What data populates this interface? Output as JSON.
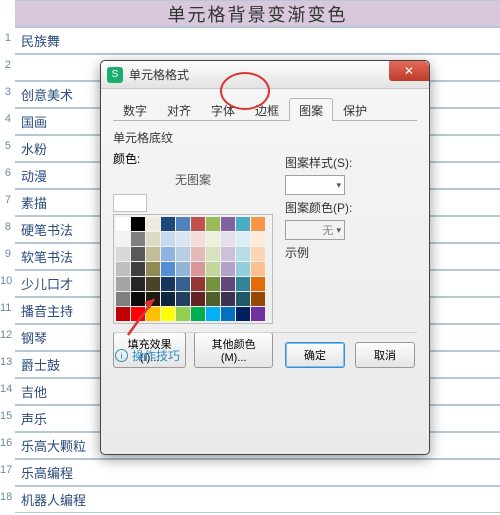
{
  "header": {
    "title": "单元格背景变渐变色"
  },
  "rows": [
    {
      "n": 1,
      "v": "民族舞"
    },
    {
      "n": 2,
      "v": ""
    },
    {
      "n": 3,
      "v": "创意美术"
    },
    {
      "n": 4,
      "v": "国画"
    },
    {
      "n": 5,
      "v": "水粉"
    },
    {
      "n": 6,
      "v": "动漫"
    },
    {
      "n": 7,
      "v": "素描"
    },
    {
      "n": 8,
      "v": "硬笔书法"
    },
    {
      "n": 9,
      "v": "软笔书法"
    },
    {
      "n": 10,
      "v": "少儿口才"
    },
    {
      "n": 11,
      "v": "播音主持"
    },
    {
      "n": 12,
      "v": "钢琴"
    },
    {
      "n": 13,
      "v": "爵士鼓"
    },
    {
      "n": 14,
      "v": "吉他"
    },
    {
      "n": 15,
      "v": "声乐"
    },
    {
      "n": 16,
      "v": "乐高大颗粒"
    },
    {
      "n": 17,
      "v": "乐高编程"
    },
    {
      "n": 18,
      "v": "机器人编程"
    }
  ],
  "dialog": {
    "app_icon_letter": "S",
    "title": "单元格格式",
    "tabs": [
      "数字",
      "对齐",
      "字体",
      "边框",
      "图案",
      "保护"
    ],
    "active_tab": 4,
    "section": "单元格底纹",
    "color_label": "颜色:",
    "no_pattern": "无图案",
    "right": {
      "style_label": "图案样式(S):",
      "color_label": "图案颜色(P):",
      "color_value": "无",
      "sample_label": "示例"
    },
    "fill_effects_btn": "填充效果(I)...",
    "other_colors_btn": "其他颜色(M)...",
    "tips": "操作技巧",
    "ok": "确定",
    "cancel": "取消"
  },
  "palette_rows": [
    [
      "#ffffff",
      "#000000",
      "#eeece1",
      "#1f497d",
      "#4f81bd",
      "#c0504d",
      "#9bbb59",
      "#8064a2",
      "#4bacc6",
      "#f79646"
    ],
    [
      "#f2f2f2",
      "#7f7f7f",
      "#ddd9c3",
      "#c6d9f0",
      "#dbe5f1",
      "#f2dcdb",
      "#ebf1dd",
      "#e5e0ec",
      "#dbeef3",
      "#fdeada"
    ],
    [
      "#d8d8d8",
      "#595959",
      "#c4bd97",
      "#8db3e2",
      "#b8cce4",
      "#e5b9b7",
      "#d7e3bc",
      "#ccc1d9",
      "#b7dde8",
      "#fbd5b5"
    ],
    [
      "#bfbfbf",
      "#3f3f3f",
      "#938953",
      "#548dd4",
      "#95b3d7",
      "#d99694",
      "#c3d69b",
      "#b2a2c7",
      "#92cddc",
      "#fac08f"
    ],
    [
      "#a5a5a5",
      "#262626",
      "#494429",
      "#17365d",
      "#366092",
      "#953734",
      "#76923c",
      "#5f497a",
      "#31859b",
      "#e36c09"
    ],
    [
      "#7f7f7f",
      "#0c0c0c",
      "#1d1b10",
      "#0f243e",
      "#244061",
      "#632423",
      "#4f6128",
      "#3f3151",
      "#205867",
      "#974806"
    ],
    [
      "#c00000",
      "#ff0000",
      "#ffc000",
      "#ffff00",
      "#92d050",
      "#00b050",
      "#00b0f0",
      "#0070c0",
      "#002060",
      "#7030a0"
    ]
  ]
}
